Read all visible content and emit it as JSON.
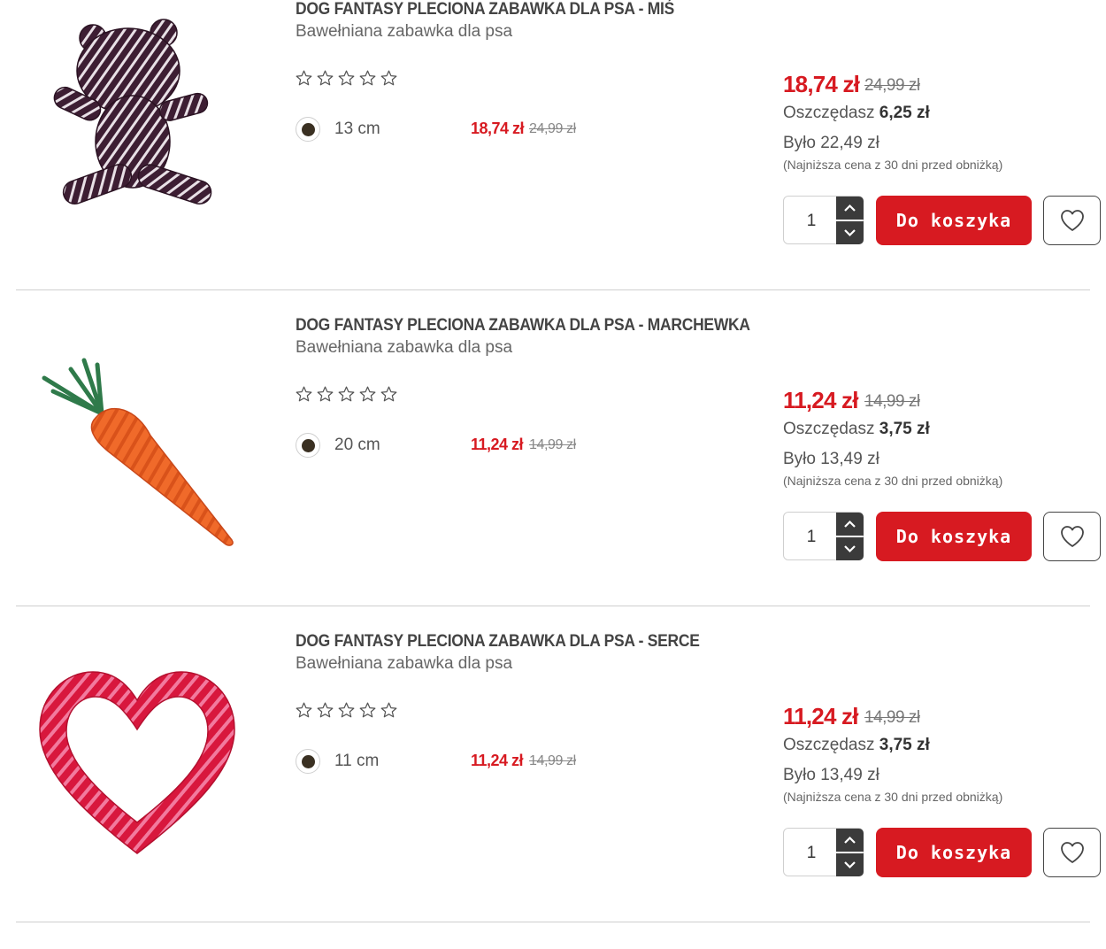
{
  "colors": {
    "accent": "#d71a21",
    "dark": "#3b3b3b",
    "variant_dot": "#3a3022"
  },
  "icons": {
    "rating": "star-outline-icon",
    "qty_up": "chevron-up-icon",
    "qty_down": "chevron-down-icon",
    "wishlist": "heart-icon"
  },
  "products": [
    {
      "title": "DOG FANTASY PLECIONA ZABAWKA DLA PSA - MIŚ",
      "subtitle": "Bawełniana zabawka dla psa",
      "rating": 0,
      "variant": {
        "size": "13 cm",
        "price": "18,74 zł",
        "old_price": "24,99 zł"
      },
      "price": "18,74 zł",
      "old_price": "24,99 zł",
      "save_label": "Oszczędasz",
      "save_amount": "6,25 zł",
      "was": "Było 22,49 zł",
      "lowest_note": "(Najniższa cena z 30 dni przed obniżką)",
      "quantity": "1",
      "cart_label": "Do koszyka"
    },
    {
      "title": "DOG FANTASY PLECIONA ZABAWKA DLA PSA - MARCHEWKA",
      "subtitle": "Bawełniana zabawka dla psa",
      "rating": 0,
      "variant": {
        "size": "20 cm",
        "price": "11,24 zł",
        "old_price": "14,99 zł"
      },
      "price": "11,24 zł",
      "old_price": "14,99 zł",
      "save_label": "Oszczędasz",
      "save_amount": "3,75 zł",
      "was": "Było 13,49 zł",
      "lowest_note": "(Najniższa cena z 30 dni przed obniżką)",
      "quantity": "1",
      "cart_label": "Do koszyka"
    },
    {
      "title": "DOG FANTASY PLECIONA ZABAWKA DLA PSA - SERCE",
      "subtitle": "Bawełniana zabawka dla psa",
      "rating": 0,
      "variant": {
        "size": "11 cm",
        "price": "11,24 zł",
        "old_price": "14,99 zł"
      },
      "price": "11,24 zł",
      "old_price": "14,99 zł",
      "save_label": "Oszczędasz",
      "save_amount": "3,75 zł",
      "was": "Było 13,49 zł",
      "lowest_note": "(Najniższa cena z 30 dni przed obniżką)",
      "quantity": "1",
      "cart_label": "Do koszyka"
    }
  ]
}
